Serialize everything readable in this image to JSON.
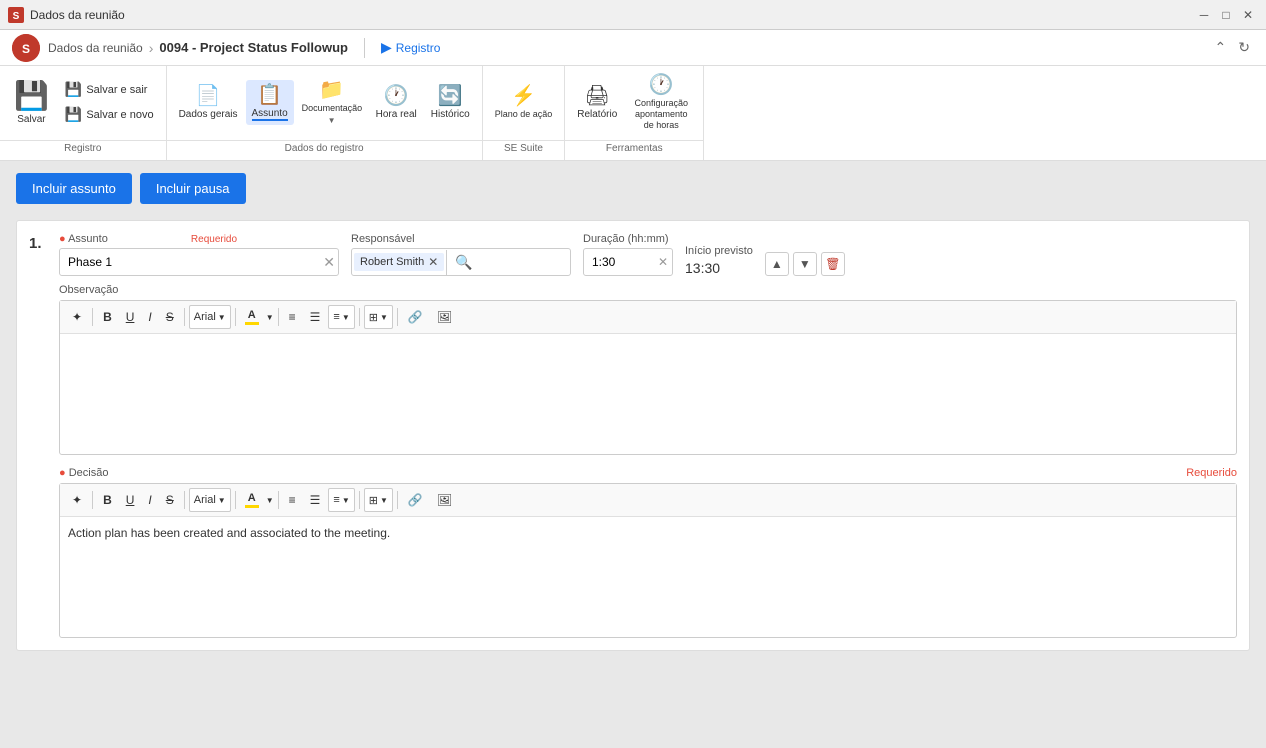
{
  "titlebar": {
    "title": "Dados da reunião",
    "controls": {
      "minimize": "─",
      "maximize": "□",
      "close": "✕"
    }
  },
  "header": {
    "logo": "S",
    "breadcrumb": {
      "parent": "Dados da reunião",
      "separator": "›",
      "current": "0094 - Project Status Followup"
    },
    "registro_label": "Registro",
    "nav_up": "⌃",
    "nav_refresh": "↻"
  },
  "ribbon": {
    "groups": [
      {
        "name": "Registro",
        "buttons": [
          {
            "id": "salvar",
            "label": "Salvar",
            "icon": "💾",
            "type": "main"
          },
          {
            "id": "salvar-e-sair",
            "label": "Salvar e sair",
            "icon": "💾"
          },
          {
            "id": "salvar-e-novo",
            "label": "Salvar e novo",
            "icon": "💾"
          }
        ]
      },
      {
        "name": "Dados do registro",
        "buttons": [
          {
            "id": "dados-gerais",
            "label": "Dados gerais",
            "icon": "📄"
          },
          {
            "id": "assunto",
            "label": "Assunto",
            "icon": "📋",
            "active": true
          },
          {
            "id": "documentacao",
            "label": "Documentação",
            "icon": "📁"
          },
          {
            "id": "hora-real",
            "label": "Hora real",
            "icon": "🕐"
          },
          {
            "id": "historico",
            "label": "Histórico",
            "icon": "🔄"
          }
        ]
      },
      {
        "name": "SE Suite",
        "buttons": [
          {
            "id": "plano-de-acao",
            "label": "Plano de ação",
            "icon": "⚡"
          }
        ]
      },
      {
        "name": "Ferramentas",
        "buttons": [
          {
            "id": "relatorio",
            "label": "Relatório",
            "icon": "🖨"
          },
          {
            "id": "configuracao",
            "label": "Configuração apontamento de horas",
            "icon": "🕐"
          }
        ]
      }
    ]
  },
  "actions": {
    "incluir_assunto": "Incluir assunto",
    "incluir_pausa": "Incluir pausa"
  },
  "item": {
    "number": "1.",
    "assunto_label": "Assunto",
    "required_label": "Requerido",
    "assunto_value": "Phase 1",
    "responsavel_label": "Responsável",
    "responsavel_value": "Robert Smith",
    "duracao_label": "Duração (hh:mm)",
    "duracao_value": "1:30",
    "inicio_label": "Início previsto",
    "inicio_value": "13:30",
    "observacao_label": "Observação",
    "decisao_label": "Decisão",
    "decisao_required": "Requerido",
    "decisao_text": "Action plan has been created and associated to the meeting."
  },
  "toolbar": {
    "font_label": "Arial",
    "format_buttons": [
      "B",
      "U",
      "I",
      "S"
    ],
    "color_highlight": "#FFFF00",
    "color_text": "#FFFF00"
  },
  "colors": {
    "primary_blue": "#1a73e8",
    "active_tab_bg": "#dce8ff",
    "toolbar_highlight": "#FFD700"
  }
}
